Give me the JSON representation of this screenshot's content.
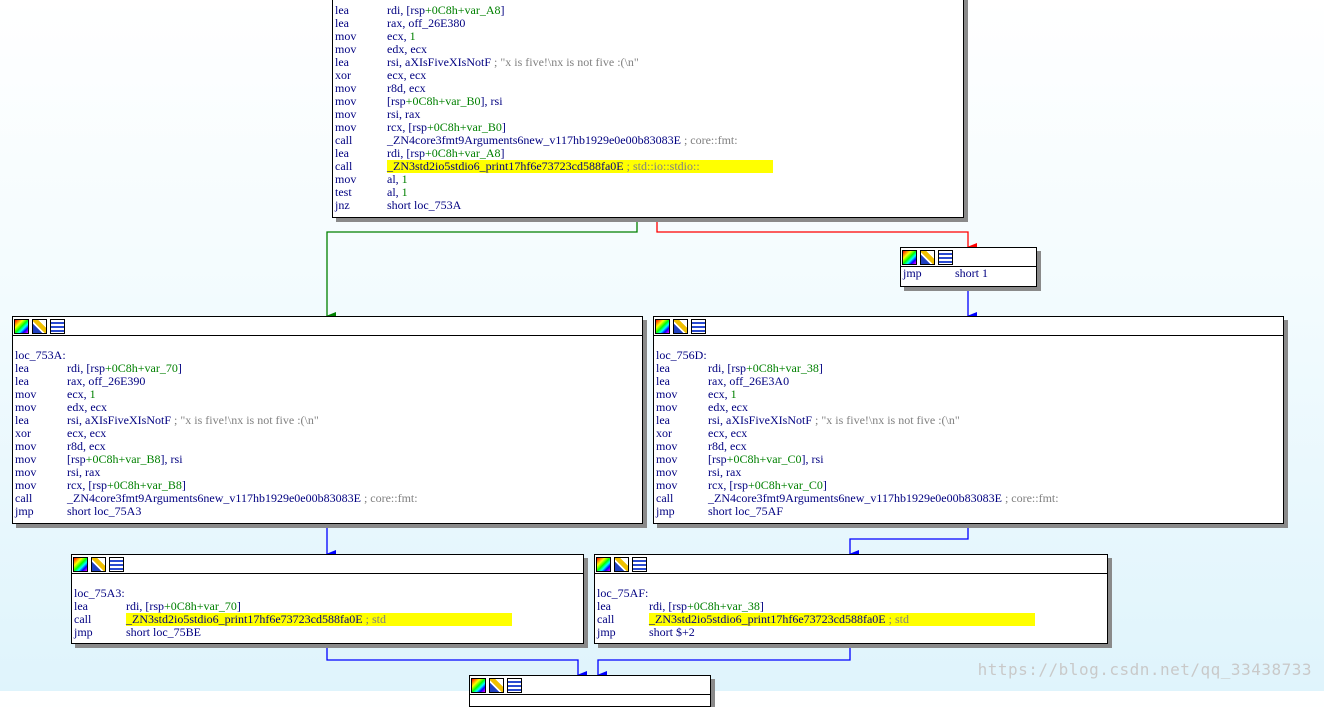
{
  "colors": {
    "true_edge": "#008000",
    "false_edge": "#ff0000",
    "jump_edge": "#0000ff",
    "highlight": "#ffff00",
    "text": "#000080",
    "var": "#008000",
    "comment": "#808080"
  },
  "node_header_icons": [
    "graph-overview-icon",
    "edit-node-icon",
    "node-list-icon"
  ],
  "nodes": {
    "top": {
      "label": "",
      "lines": [
        {
          "mn": "lea",
          "ops": "rdi, [rsp+0C8h+var_A8]",
          "cmt": ""
        },
        {
          "mn": "lea",
          "ops": "rax, off_26E380",
          "cmt": ""
        },
        {
          "mn": "mov",
          "ops": "ecx, 1",
          "cmt": ""
        },
        {
          "mn": "mov",
          "ops": "edx, ecx",
          "cmt": ""
        },
        {
          "mn": "lea",
          "ops": "rsi, aXIsFiveXIsNotF",
          "cmt": "; \"x is five!\\nx is not five :(\\n\""
        },
        {
          "mn": "xor",
          "ops": "ecx, ecx",
          "cmt": ""
        },
        {
          "mn": "mov",
          "ops": "r8d, ecx",
          "cmt": ""
        },
        {
          "mn": "mov",
          "ops": "[rsp+0C8h+var_B0], rsi",
          "cmt": ""
        },
        {
          "mn": "mov",
          "ops": "rsi, rax",
          "cmt": ""
        },
        {
          "mn": "mov",
          "ops": "rcx, [rsp+0C8h+var_B0]",
          "cmt": ""
        },
        {
          "mn": "call",
          "ops": "_ZN4core3fmt9Arguments6new_v117hb1929e0e00b83083E",
          "cmt": "; core::fmt:"
        },
        {
          "mn": "lea",
          "ops": "rdi, [rsp+0C8h+var_A8]",
          "cmt": ""
        },
        {
          "mn": "call",
          "ops": "_ZN3std2io5stdio6_print17hf6e73723cd588fa0E",
          "cmt": "; std::io::stdio::",
          "hl": true
        },
        {
          "mn": "mov",
          "ops": "al, 1",
          "cmt": ""
        },
        {
          "mn": "test",
          "ops": "al, 1",
          "cmt": ""
        },
        {
          "mn": "jnz",
          "ops": "short loc_753A",
          "cmt": ""
        }
      ]
    },
    "jmp1": {
      "label": "",
      "lines": [
        {
          "mn": "jmp",
          "ops": "short 1",
          "cmt": ""
        }
      ]
    },
    "loc753a": {
      "label": "loc_753A:",
      "lines": [
        {
          "mn": "lea",
          "ops": "rdi, [rsp+0C8h+var_70]",
          "cmt": ""
        },
        {
          "mn": "lea",
          "ops": "rax, off_26E390",
          "cmt": ""
        },
        {
          "mn": "mov",
          "ops": "ecx, 1",
          "cmt": ""
        },
        {
          "mn": "mov",
          "ops": "edx, ecx",
          "cmt": ""
        },
        {
          "mn": "lea",
          "ops": "rsi, aXIsFiveXIsNotF",
          "cmt": "; \"x is five!\\nx is not five :(\\n\""
        },
        {
          "mn": "xor",
          "ops": "ecx, ecx",
          "cmt": ""
        },
        {
          "mn": "mov",
          "ops": "r8d, ecx",
          "cmt": ""
        },
        {
          "mn": "mov",
          "ops": "[rsp+0C8h+var_B8], rsi",
          "cmt": ""
        },
        {
          "mn": "mov",
          "ops": "rsi, rax",
          "cmt": ""
        },
        {
          "mn": "mov",
          "ops": "rcx, [rsp+0C8h+var_B8]",
          "cmt": ""
        },
        {
          "mn": "call",
          "ops": "_ZN4core3fmt9Arguments6new_v117hb1929e0e00b83083E",
          "cmt": "; core::fmt:"
        },
        {
          "mn": "jmp",
          "ops": "short loc_75A3",
          "cmt": ""
        }
      ]
    },
    "loc756d": {
      "label": "loc_756D:",
      "lines": [
        {
          "mn": "lea",
          "ops": "rdi, [rsp+0C8h+var_38]",
          "cmt": ""
        },
        {
          "mn": "lea",
          "ops": "rax, off_26E3A0",
          "cmt": ""
        },
        {
          "mn": "mov",
          "ops": "ecx, 1",
          "cmt": ""
        },
        {
          "mn": "mov",
          "ops": "edx, ecx",
          "cmt": ""
        },
        {
          "mn": "lea",
          "ops": "rsi, aXIsFiveXIsNotF",
          "cmt": "; \"x is five!\\nx is not five :(\\n\""
        },
        {
          "mn": "xor",
          "ops": "ecx, ecx",
          "cmt": ""
        },
        {
          "mn": "mov",
          "ops": "r8d, ecx",
          "cmt": ""
        },
        {
          "mn": "mov",
          "ops": "[rsp+0C8h+var_C0], rsi",
          "cmt": ""
        },
        {
          "mn": "mov",
          "ops": "rsi, rax",
          "cmt": ""
        },
        {
          "mn": "mov",
          "ops": "rcx, [rsp+0C8h+var_C0]",
          "cmt": ""
        },
        {
          "mn": "call",
          "ops": "_ZN4core3fmt9Arguments6new_v117hb1929e0e00b83083E",
          "cmt": "; core::fmt:"
        },
        {
          "mn": "jmp",
          "ops": "short loc_75AF",
          "cmt": ""
        }
      ]
    },
    "loc75a3": {
      "label": "loc_75A3:",
      "lines": [
        {
          "mn": "lea",
          "ops": "rdi, [rsp+0C8h+var_70]",
          "cmt": ""
        },
        {
          "mn": "call",
          "ops": "_ZN3std2io5stdio6_print17hf6e73723cd588fa0E",
          "cmt": "; std",
          "hl": true
        },
        {
          "mn": "jmp",
          "ops": "short loc_75BE",
          "cmt": ""
        }
      ]
    },
    "loc75af": {
      "label": "loc_75AF:",
      "lines": [
        {
          "mn": "lea",
          "ops": "rdi, [rsp+0C8h+var_38]",
          "cmt": ""
        },
        {
          "mn": "call",
          "ops": "_ZN3std2io5stdio6_print17hf6e73723cd588fa0E",
          "cmt": "; std",
          "hl": true
        },
        {
          "mn": "jmp",
          "ops": "short $+2",
          "cmt": ""
        }
      ]
    },
    "bottom": {
      "label": "",
      "lines": []
    }
  },
  "watermark": "https://blog.csdn.net/qq_33438733"
}
